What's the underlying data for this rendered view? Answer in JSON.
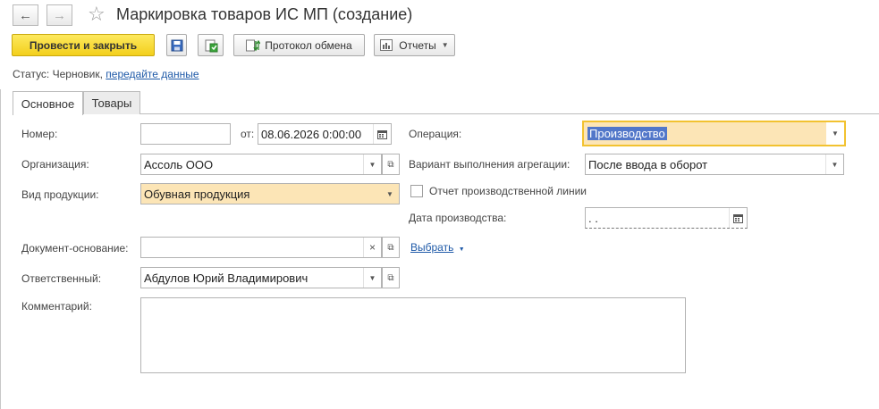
{
  "window": {
    "title": "Маркировка товаров ИС МП (создание)",
    "nav_back": "←",
    "nav_forward": "→"
  },
  "toolbar": {
    "post_close_label": "Провести и закрыть",
    "exchange_protocol_label": "Протокол обмена",
    "reports_label": "Отчеты"
  },
  "status": {
    "label": "Статус:",
    "value": "Черновик,",
    "link": "передайте данные"
  },
  "tabs": [
    {
      "label": "Основное",
      "active": true
    },
    {
      "label": "Товары",
      "active": false
    }
  ],
  "form": {
    "number_label": "Номер:",
    "number_value": "",
    "date_from_label": "от:",
    "date_value": "08.06.2026  0:00:00",
    "organization_label": "Организация:",
    "organization_value": "Ассоль ООО",
    "product_type_label": "Вид продукции:",
    "product_type_value": "Обувная продукция",
    "basis_doc_label": "Документ-основание:",
    "basis_doc_value": "",
    "select_link": "Выбрать",
    "responsible_label": "Ответственный:",
    "responsible_value": "Абдулов Юрий Владимирович",
    "comment_label": "Комментарий:",
    "comment_value": "",
    "operation_label": "Операция:",
    "operation_value": "Производство",
    "aggregation_label": "Вариант выполнения агрегации:",
    "aggregation_value": "После ввода в оборот",
    "production_line_report_label": "Отчет производственной линии",
    "production_line_report_checked": false,
    "production_date_label": "Дата производства:",
    "production_date_value": "  .  ."
  },
  "colors": {
    "primary_button": "#f3cf1c",
    "highlight_field": "#fce5b6",
    "focus_border": "#f2c230",
    "link": "#1f5aa8"
  }
}
